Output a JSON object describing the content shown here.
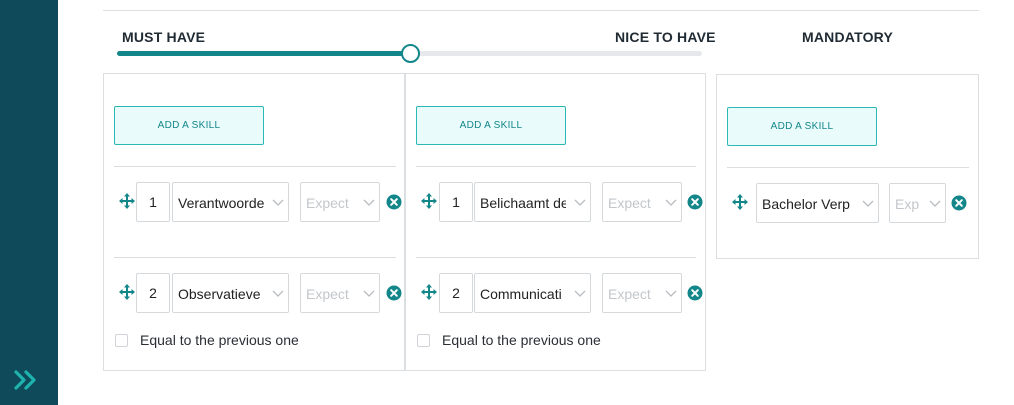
{
  "sidebar": {
    "expand_icon": "double-chevron-right-icon",
    "bg_color": "#0e4a5a",
    "icon_color": "#1fb3ae"
  },
  "header": {
    "must_have": "MUST HAVE",
    "nice_to_have": "NICE TO HAVE",
    "mandatory": "MANDATORY"
  },
  "slider": {
    "value_percent": 50,
    "accent": "#13868a"
  },
  "add_skill_label": "ADD A SKILL",
  "placeholder_expect": "Expect",
  "placeholder_exp": "Exp",
  "columns": {
    "must_have": {
      "rows": [
        {
          "rank": "1",
          "skill": "Verantwoorde"
        },
        {
          "rank": "2",
          "skill": "Observatieve"
        }
      ],
      "equal_label": "Equal to the previous one"
    },
    "nice_to_have": {
      "rows": [
        {
          "rank": "1",
          "skill": "Belichaamt de"
        },
        {
          "rank": "2",
          "skill": "Communicati"
        }
      ],
      "equal_label": "Equal to the previous one"
    },
    "mandatory": {
      "rows": [
        {
          "skill": "Bachelor Verp"
        }
      ]
    }
  }
}
